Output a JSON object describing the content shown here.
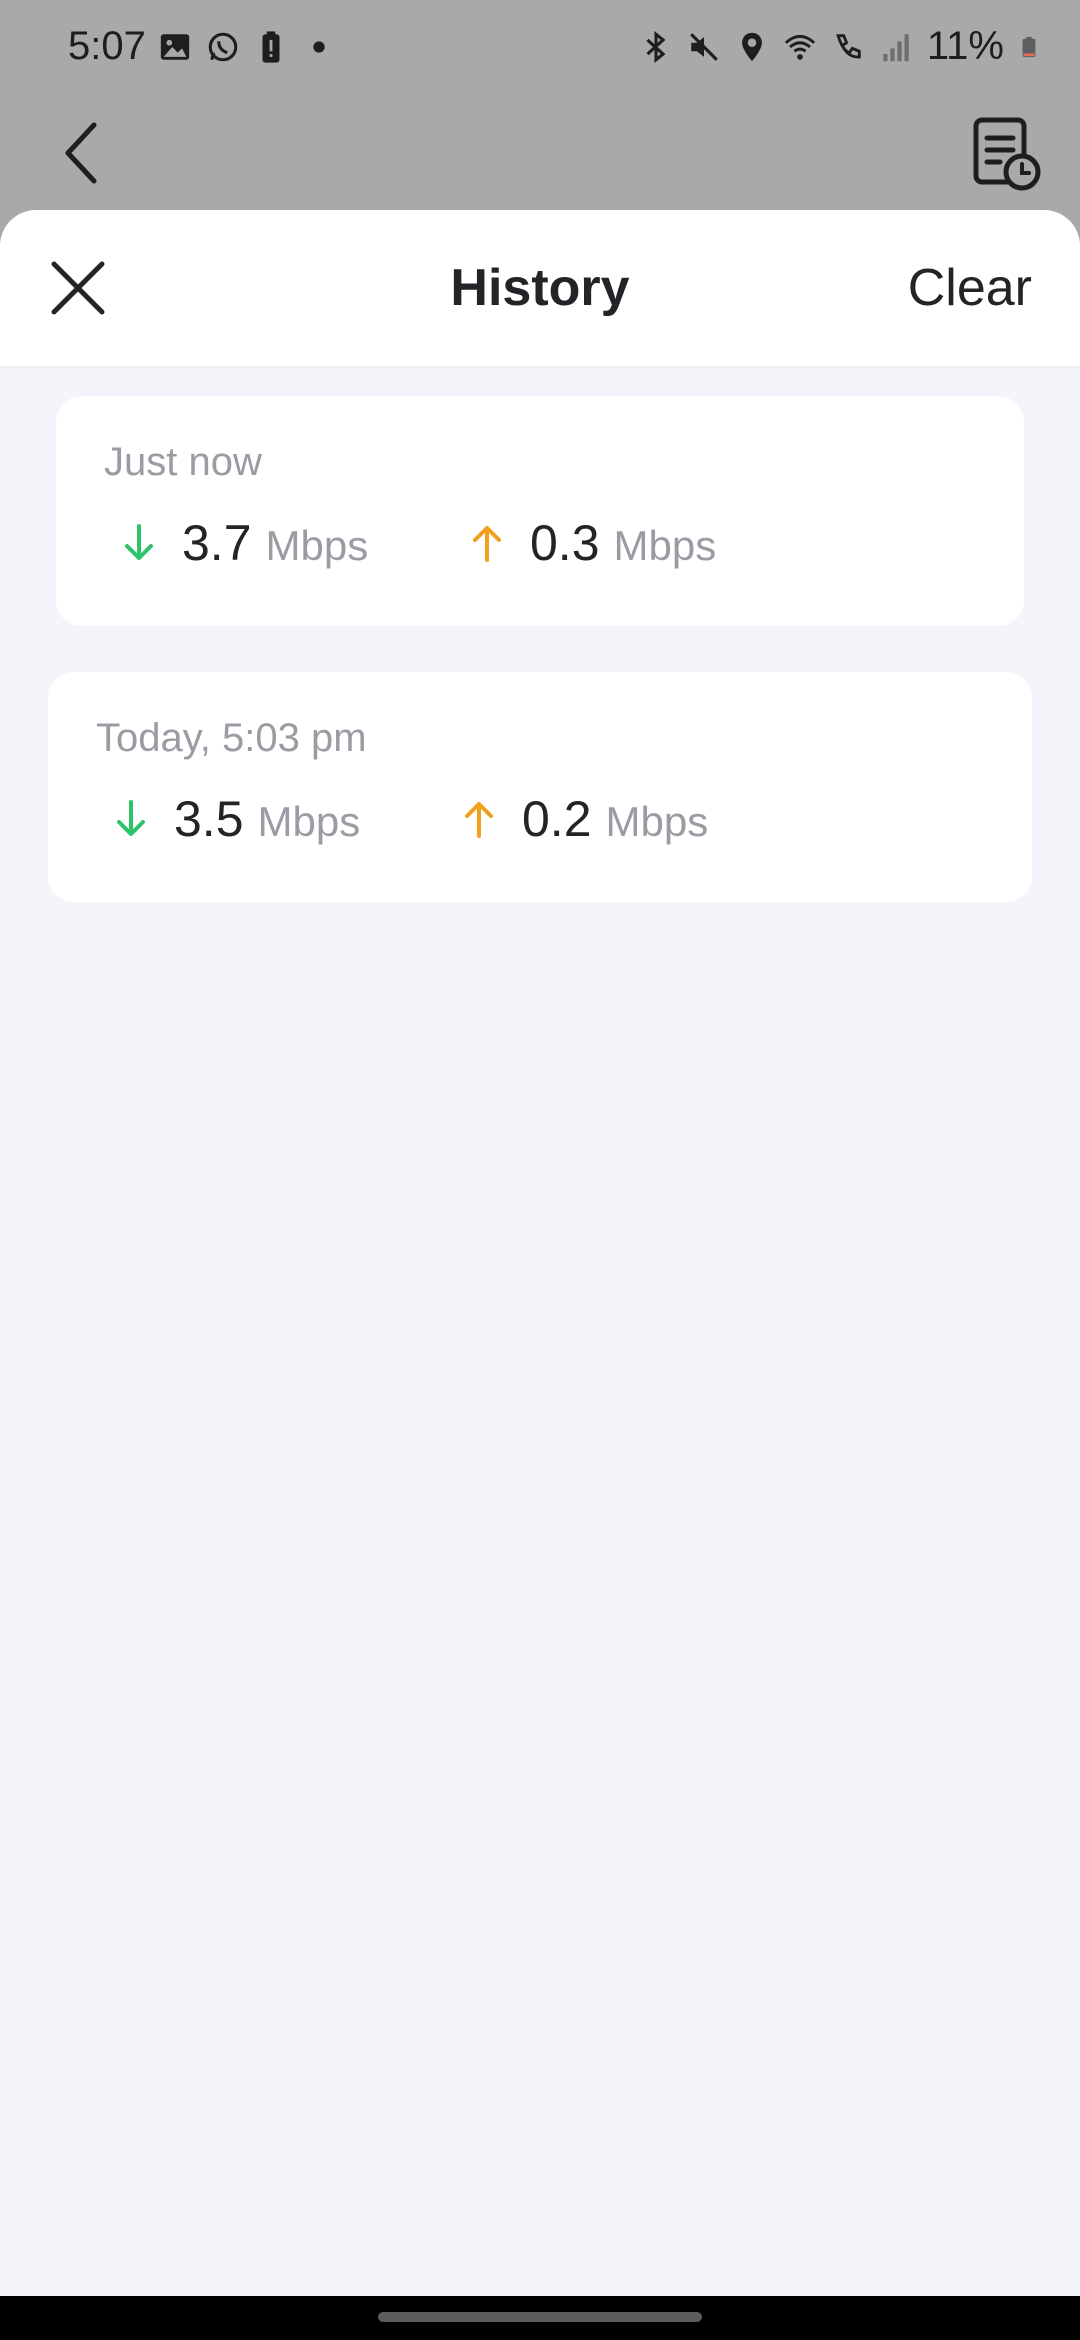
{
  "status_bar": {
    "time": "5:07",
    "battery": "11%",
    "left_icons": [
      "gallery-icon",
      "whatsapp-icon",
      "battery-alert-icon",
      "dot-icon"
    ],
    "right_icons": [
      "bluetooth-icon",
      "mute-icon",
      "location-icon",
      "wifi-icon",
      "wifi-call-icon",
      "signal-icon"
    ]
  },
  "sheet": {
    "title": "History",
    "clear_label": "Clear"
  },
  "history": [
    {
      "time": "Just now",
      "download": "3.7",
      "download_unit": "Mbps",
      "upload": "0.3",
      "upload_unit": "Mbps"
    },
    {
      "time": "Today, 5:03 pm",
      "download": "3.5",
      "download_unit": "Mbps",
      "upload": "0.2",
      "upload_unit": "Mbps"
    }
  ],
  "colors": {
    "download_arrow": "#2bc46a",
    "upload_arrow": "#f2a01c"
  }
}
